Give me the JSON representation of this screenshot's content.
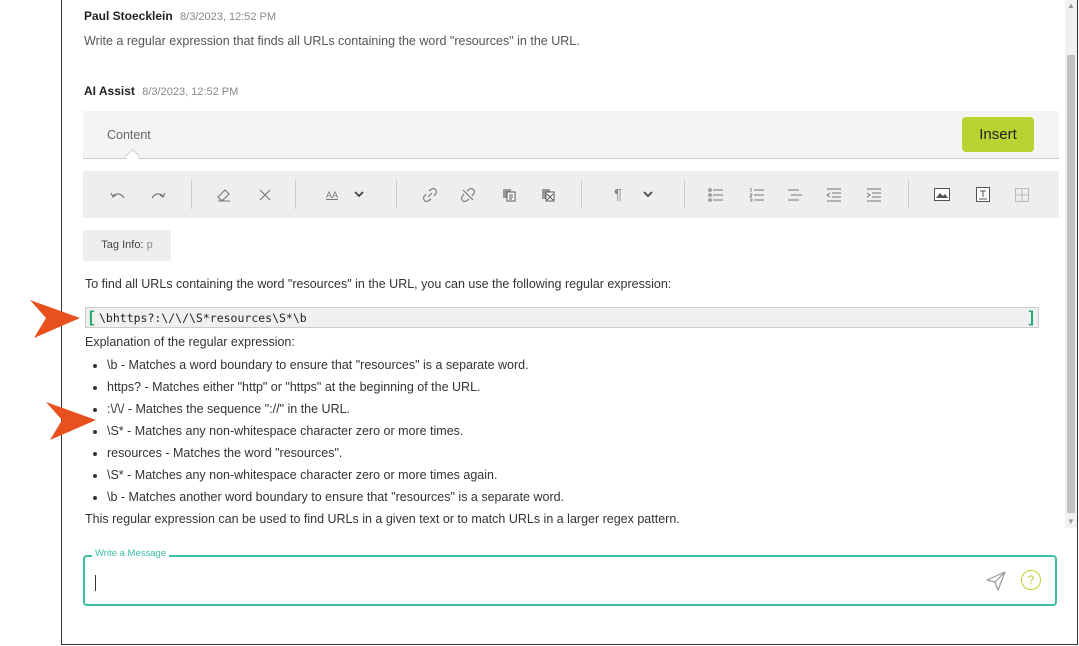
{
  "messages": [
    {
      "author": "Paul Stoecklein",
      "time": "8/3/2023, 12:52 PM",
      "text": "Write a regular expression that finds all URLs containing the word \"resources\" in the URL."
    },
    {
      "author": "AI Assist",
      "time": "8/3/2023, 12:52 PM"
    }
  ],
  "editor": {
    "content_tab": "Content",
    "insert_label": "Insert",
    "toolbar_icons": [
      "undo-icon",
      "redo-icon",
      "eraser-icon",
      "clear-icon",
      "font-size-icon",
      "link-icon",
      "unlink-icon",
      "copy-format-icon",
      "paste-format-icon",
      "paragraph-icon",
      "bulleted-list-icon",
      "numbered-list-icon",
      "multilevel-list-icon",
      "decrease-indent-icon",
      "increase-indent-icon",
      "image-icon",
      "text-frame-icon",
      "table-icon"
    ],
    "font_size_glyph": "AA",
    "paragraph_glyph": "¶",
    "tag_info_label": "Tag Info:",
    "tag_info_value": "p"
  },
  "response": {
    "intro": "To find all URLs containing the word \"resources\" in the URL, you can use the following regular expression:",
    "code": "\\bhttps?:\\/\\/\\S*resources\\S*\\b",
    "code_open": "[",
    "code_close": "]",
    "explanation_title": "Explanation of the regular expression:",
    "explanation": [
      "\\b - Matches a word boundary to ensure that \"resources\" is a separate word.",
      "https? - Matches either \"http\" or \"https\" at the beginning of the URL.",
      ":\\/\\/ - Matches the sequence \"://\" in the URL.",
      "\\S* - Matches any non-whitespace character zero or more times.",
      "resources - Matches the word \"resources\".",
      "\\S* - Matches any non-whitespace character zero or more times again.",
      "\\b - Matches another word boundary to ensure that \"resources\" is a separate word."
    ],
    "closing": "This regular expression can be used to find URLs in a given text or to match URLs in a larger regex pattern."
  },
  "composer": {
    "legend": "Write a Message",
    "value": "",
    "help_glyph": "?"
  },
  "colors": {
    "accent_green": "#b8d432",
    "teal": "#3bbfa5",
    "arrow": "#e8501e"
  }
}
